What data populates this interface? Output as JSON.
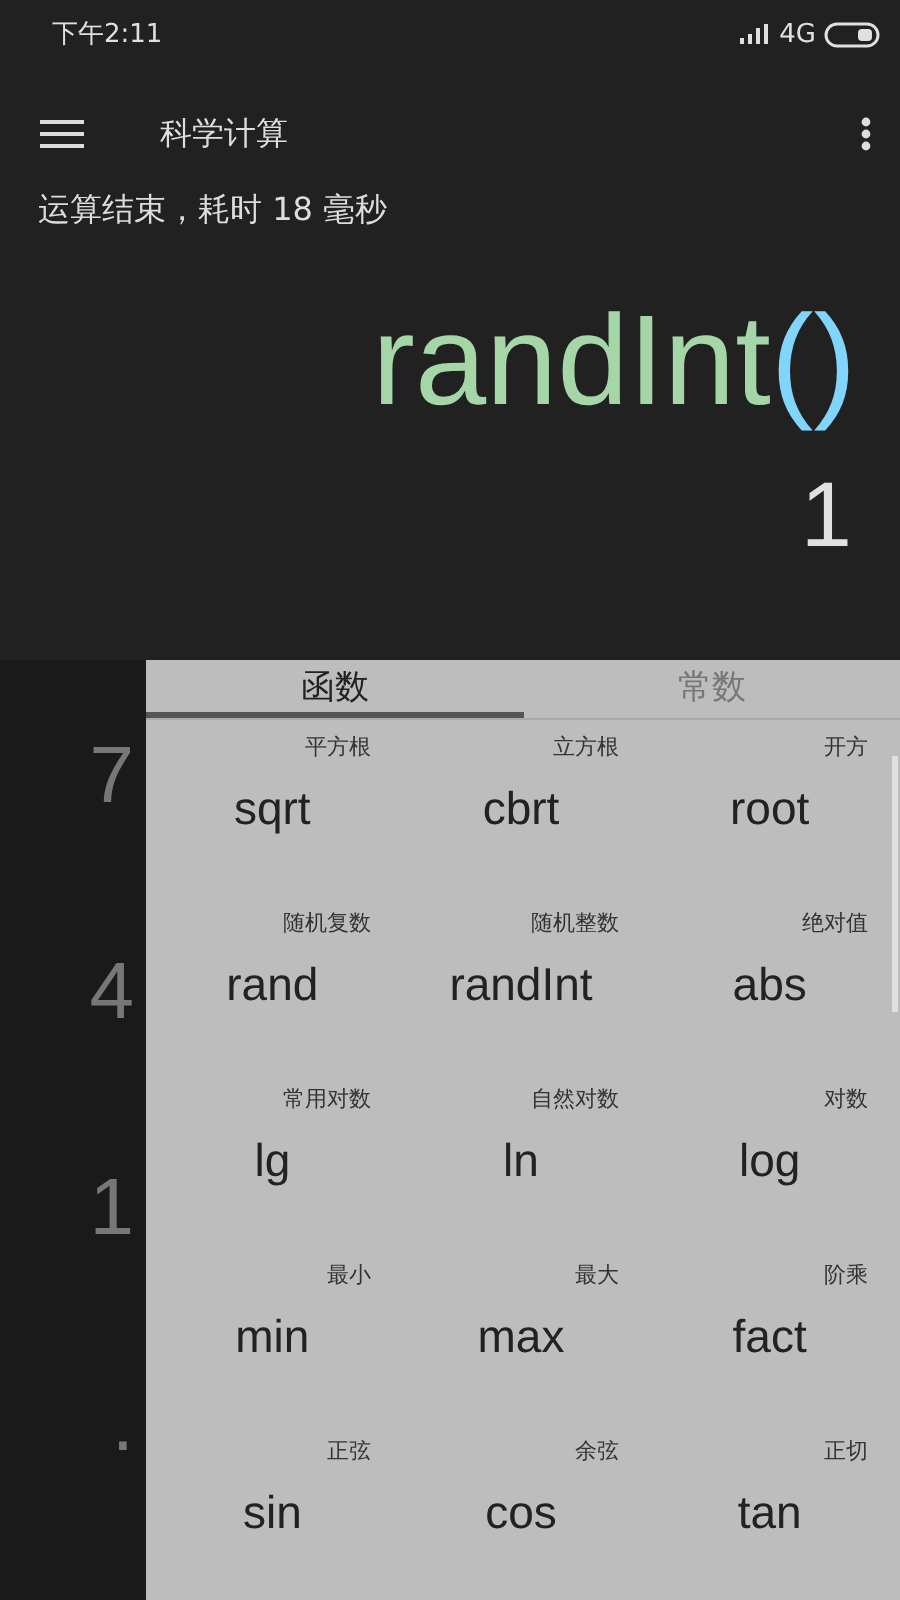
{
  "status_bar": {
    "time": "下午2:11",
    "network": "4G"
  },
  "toolbar": {
    "title": "科学计算"
  },
  "message": "运算结束，耗时 18 毫秒",
  "expression": {
    "name": "randInt",
    "parens": "()"
  },
  "result": "1",
  "keypad_keys": [
    "7",
    "4",
    "1",
    "."
  ],
  "tabs": [
    {
      "label": "函数",
      "selected": true
    },
    {
      "label": "常数",
      "selected": false
    }
  ],
  "functions": [
    {
      "label": "平方根",
      "name": "sqrt"
    },
    {
      "label": "立方根",
      "name": "cbrt"
    },
    {
      "label": "开方",
      "name": "root"
    },
    {
      "label": "随机复数",
      "name": "rand"
    },
    {
      "label": "随机整数",
      "name": "randInt"
    },
    {
      "label": "绝对值",
      "name": "abs"
    },
    {
      "label": "常用对数",
      "name": "lg"
    },
    {
      "label": "自然对数",
      "name": "ln"
    },
    {
      "label": "对数",
      "name": "log"
    },
    {
      "label": "最小",
      "name": "min"
    },
    {
      "label": "最大",
      "name": "max"
    },
    {
      "label": "阶乘",
      "name": "fact"
    },
    {
      "label": "正弦",
      "name": "sin"
    },
    {
      "label": "余弦",
      "name": "cos"
    },
    {
      "label": "正切",
      "name": "tan"
    }
  ]
}
